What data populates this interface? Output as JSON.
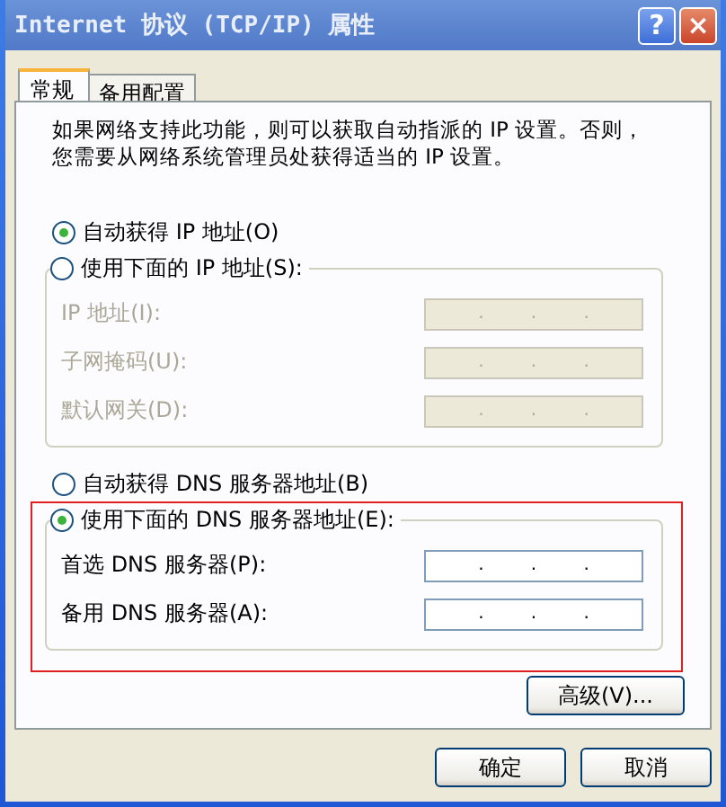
{
  "window": {
    "title": "Internet 协议 (TCP/IP) 属性"
  },
  "title_buttons": [
    {
      "kind": "help",
      "label": "?"
    },
    {
      "kind": "close",
      "label": "×"
    }
  ],
  "tabs": [
    {
      "label": "常规",
      "selected": true
    },
    {
      "label": "备用配置",
      "selected": false
    }
  ],
  "intro": [
    "如果网络支持此功能，则可以获取自动指派的 IP 设置。否则，",
    "您需要从网络系统管理员处获得适当的 IP 设置。"
  ],
  "ip_options": [
    {
      "label": "自动获得 IP 地址(O)",
      "selected": true
    },
    {
      "label": "使用下面的 IP 地址(S):",
      "selected": false
    }
  ],
  "ip_fields": [
    {
      "label": "IP 地址(I):",
      "disabled": true,
      "separators": [
        ".",
        ".",
        "."
      ]
    },
    {
      "label": "子网掩码(U):",
      "disabled": true,
      "separators": [
        ".",
        ".",
        "."
      ]
    },
    {
      "label": "默认网关(D):",
      "disabled": true,
      "separators": [
        ".",
        ".",
        "."
      ]
    }
  ],
  "dns_options": [
    {
      "label": "自动获得 DNS 服务器地址(B)",
      "selected": false
    },
    {
      "label": "使用下面的 DNS 服务器地址(E):",
      "selected": true
    }
  ],
  "dns_fields": [
    {
      "label": "首选 DNS 服务器(P):",
      "disabled": false,
      "separators": [
        ".",
        ".",
        "."
      ]
    },
    {
      "label": "备用 DNS 服务器(A):",
      "disabled": false,
      "separators": [
        ".",
        ".",
        "."
      ]
    }
  ],
  "highlight": {
    "kind": "frame"
  },
  "advanced_button": "高级(V)...",
  "buttons": [
    "确定",
    "取消"
  ]
}
